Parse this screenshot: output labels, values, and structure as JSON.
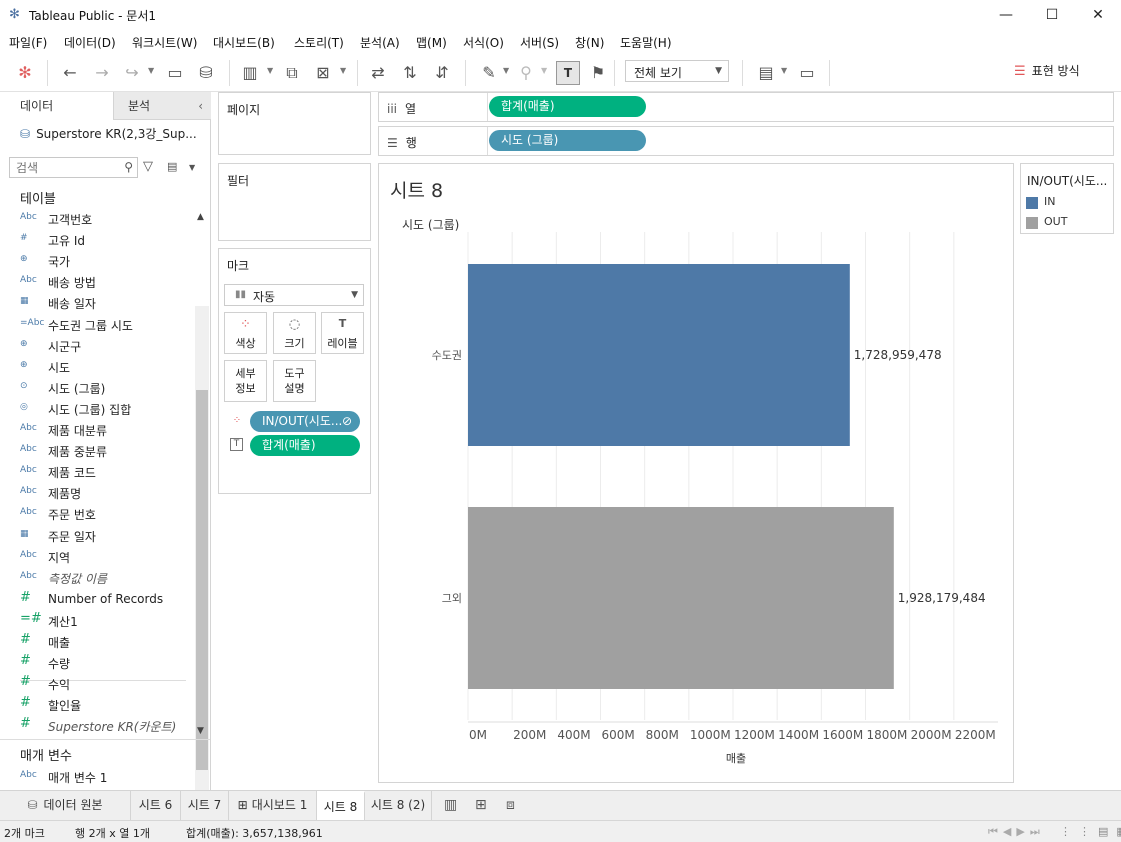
{
  "window": {
    "title": "Tableau Public - 문서1",
    "minimize": "—",
    "maximize": "☐",
    "close": "✕"
  },
  "menu": [
    "파일(F)",
    "데이터(D)",
    "워크시트(W)",
    "대시보드(B)",
    "스토리(T)",
    "분석(A)",
    "맵(M)",
    "서식(O)",
    "서버(S)",
    "창(N)",
    "도움말(H)"
  ],
  "toolbar": {
    "view_mode": "전체 보기",
    "show_me": "표현 방식"
  },
  "data_pane": {
    "tab_data": "데이터",
    "tab_analysis": "분석",
    "datasource": "Superstore KR(2,3강_Sup...",
    "search_placeholder": "검색",
    "tables_heading": "테이블",
    "params_heading": "매개 변수",
    "dimensions": [
      {
        "type": "Abc",
        "name": "고객번호"
      },
      {
        "type": "#",
        "name": "고유 Id"
      },
      {
        "type": "⊕",
        "name": "국가"
      },
      {
        "type": "Abc",
        "name": "배송 방법"
      },
      {
        "type": "▦",
        "name": "배송 일자"
      },
      {
        "type": "=Abc",
        "name": "수도권 그룹 시도"
      },
      {
        "type": "⊕",
        "name": "시군구"
      },
      {
        "type": "⊕",
        "name": "시도"
      },
      {
        "type": "⊙",
        "name": "시도 (그룹)"
      },
      {
        "type": "◎",
        "name": "시도 (그룹) 집합"
      },
      {
        "type": "Abc",
        "name": "제품 대분류"
      },
      {
        "type": "Abc",
        "name": "제품 중분류"
      },
      {
        "type": "Abc",
        "name": "제품 코드"
      },
      {
        "type": "Abc",
        "name": "제품명"
      },
      {
        "type": "Abc",
        "name": "주문 번호"
      },
      {
        "type": "▦",
        "name": "주문 일자"
      },
      {
        "type": "Abc",
        "name": "지역"
      },
      {
        "type": "Abc",
        "name": "측정값 이름"
      }
    ],
    "measures": [
      {
        "type": "#",
        "name": "Number of Records"
      },
      {
        "type": "=#",
        "name": "계산1"
      },
      {
        "type": "#",
        "name": "매출"
      },
      {
        "type": "#",
        "name": "수량"
      },
      {
        "type": "#",
        "name": "수익"
      },
      {
        "type": "#",
        "name": "할인율"
      },
      {
        "type": "#",
        "name": "Superstore KR(카운트)"
      }
    ],
    "parameters": [
      {
        "type": "Abc",
        "name": "매개 변수 1"
      }
    ]
  },
  "cards": {
    "pages": "페이지",
    "filters": "필터",
    "marks": "마크",
    "mark_type": "자동",
    "color": "색상",
    "size": "크기",
    "label": "레이블",
    "detail": "세부\n정보",
    "detail_1": "세부",
    "detail_2": "정보",
    "tooltip_1": "도구",
    "tooltip_2": "설명",
    "color_pill": "IN/OUT(시도...",
    "label_pill": "합계(매출)"
  },
  "shelves": {
    "columns_label": "열",
    "rows_label": "행",
    "columns_pill": "합계(매출)",
    "rows_pill": "시도 (그룹)"
  },
  "sheet": {
    "title": "시트 8",
    "row_header": "시도 (그룹)"
  },
  "legend": {
    "title": "IN/OUT(시도...",
    "items": [
      {
        "label": "IN",
        "color": "#4e79a7"
      },
      {
        "label": "OUT",
        "color": "#a0a0a0"
      }
    ]
  },
  "chart_data": {
    "type": "bar",
    "orientation": "horizontal",
    "categories": [
      "수도권",
      "그외"
    ],
    "values": [
      1728959478,
      1928179484
    ],
    "value_labels": [
      "1,728,959,478",
      "1,928,179,484"
    ],
    "colors": [
      "#4e79a7",
      "#a0a0a0"
    ],
    "xlabel": "매출",
    "ylabel": "시도 (그룹)",
    "xlim": [
      0,
      2400000000
    ],
    "xticks": [
      0,
      200000000,
      400000000,
      600000000,
      800000000,
      1000000000,
      1200000000,
      1400000000,
      1600000000,
      1800000000,
      2000000000,
      2200000000
    ],
    "xtick_labels": [
      "0M",
      "200M",
      "400M",
      "600M",
      "800M",
      "1000M",
      "1200M",
      "1400M",
      "1600M",
      "1800M",
      "2000M",
      "2200M"
    ],
    "grid": true
  },
  "tabs": {
    "datasource": "데이터 원본",
    "sheets": [
      "시트 6",
      "시트 7",
      "대시보드 1",
      "시트 8",
      "시트 8 (2)"
    ],
    "active": "시트 8"
  },
  "status": {
    "marks": "2개 마크",
    "rows_cols": "행 2개  x  열 1개",
    "sum": "합계(매출): 3,657,138,961"
  }
}
